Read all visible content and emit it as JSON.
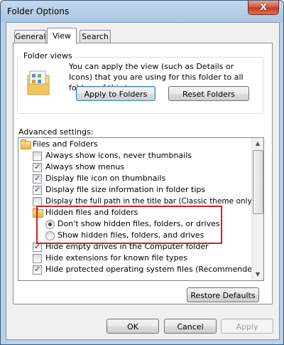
{
  "window": {
    "title": "Folder Options",
    "close_label": "X"
  },
  "tabs": [
    {
      "label": "General",
      "active": false
    },
    {
      "label": "View",
      "active": true
    },
    {
      "label": "Search",
      "active": false
    }
  ],
  "folder_views": {
    "group_label": "Folder views",
    "description": "You can apply the view (such as Details or Icons) that you are using for this folder to all folders of this type.",
    "apply_button": "Apply to Folders",
    "reset_button": "Reset Folders"
  },
  "advanced": {
    "label": "Advanced settings:",
    "items": [
      {
        "type": "folder",
        "text": "Files and Folders"
      },
      {
        "type": "checkbox",
        "text": "Always show icons, never thumbnails",
        "checked": false
      },
      {
        "type": "checkbox",
        "text": "Always show menus",
        "checked": true
      },
      {
        "type": "checkbox",
        "text": "Display file icon on thumbnails",
        "checked": true
      },
      {
        "type": "checkbox",
        "text": "Display file size information in folder tips",
        "checked": true
      },
      {
        "type": "checkbox",
        "text": "Display the full path in the title bar (Classic theme only)",
        "checked": false
      },
      {
        "type": "folder",
        "text": "Hidden files and folders"
      },
      {
        "type": "radio",
        "text": "Don't show hidden files, folders, or drives",
        "checked": true
      },
      {
        "type": "radio",
        "text": "Show hidden files, folders, and drives",
        "checked": false
      },
      {
        "type": "checkbox",
        "text": "Hide empty drives in the Computer folder",
        "checked": true
      },
      {
        "type": "checkbox",
        "text": "Hide extensions for known file types",
        "checked": false
      },
      {
        "type": "checkbox",
        "text": "Hide protected operating system files (Recommended)",
        "checked": true
      }
    ]
  },
  "restore_defaults": "Restore Defaults",
  "footer": {
    "ok": "OK",
    "cancel": "Cancel",
    "apply": "Apply"
  },
  "colors": {
    "highlight_border": "#d91c1c",
    "title_bar": "#b9d1ea",
    "check_mark": "#2a3b6b"
  }
}
